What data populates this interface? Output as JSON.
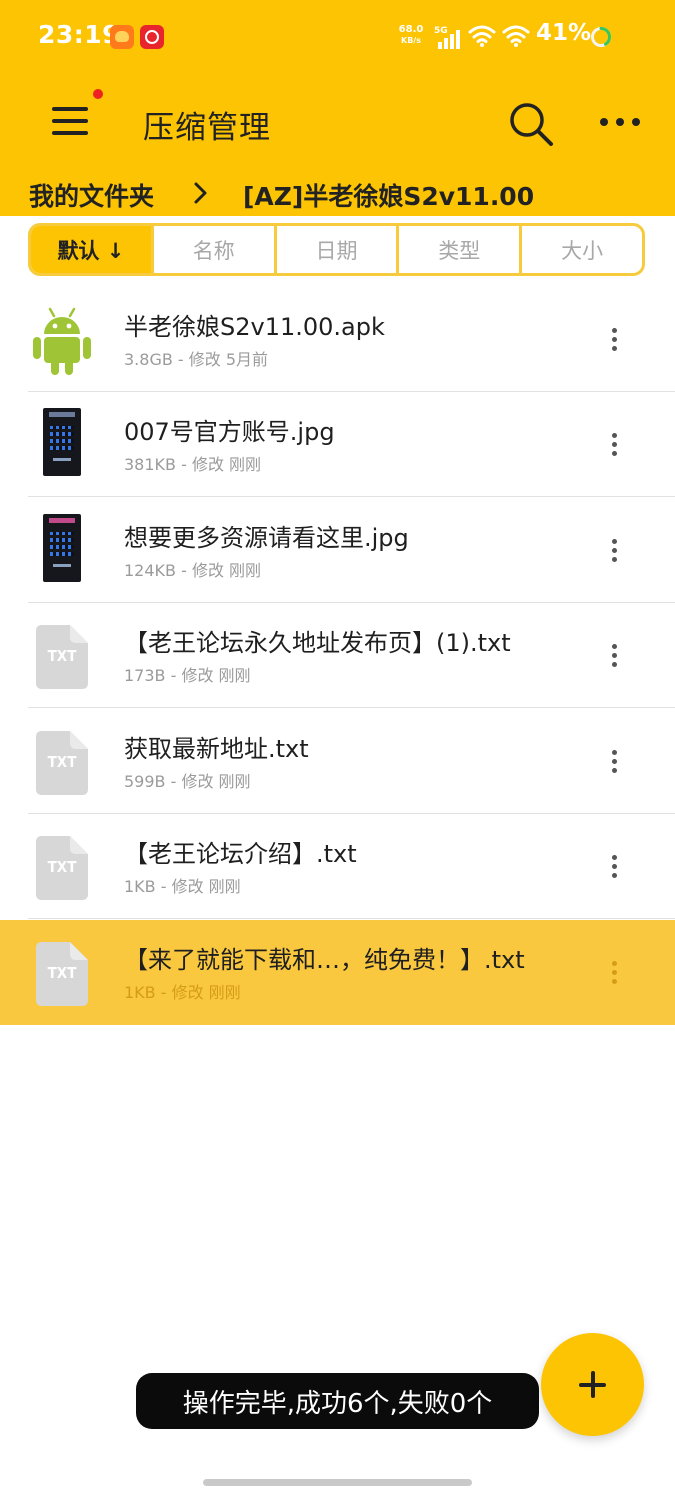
{
  "status_bar": {
    "time": "23:19",
    "net_speed_value": "68.0",
    "net_speed_unit": "KB/s",
    "signal_label": "5G",
    "battery": "41%",
    "battery_level": 0.41,
    "app_icons": [
      "taobao-app-icon",
      "netease-music-app-icon"
    ]
  },
  "toolbar": {
    "title": "压缩管理",
    "menu_icon": "hamburger-menu-icon",
    "has_notification_dot": true,
    "search_icon": "search-icon",
    "more_icon": "more-horizontal-icon"
  },
  "breadcrumb": {
    "root": "我的文件夹",
    "separator_icon": "chevron-right-icon",
    "current": "[AZ]半老徐娘S2v11.00"
  },
  "sort_tabs": [
    {
      "label": "默认 ↓",
      "active": true
    },
    {
      "label": "名称",
      "active": false
    },
    {
      "label": "日期",
      "active": false
    },
    {
      "label": "类型",
      "active": false
    },
    {
      "label": "大小",
      "active": false
    }
  ],
  "files": [
    {
      "name": "半老徐娘S2v11.00.apk",
      "meta": "3.8GB - 修改 5月前",
      "type": "apk",
      "icon": "android-apk-icon"
    },
    {
      "name": "007号官方账号.jpg",
      "meta": "381KB - 修改 刚刚",
      "type": "image",
      "icon": "image-thumbnail"
    },
    {
      "name": "想要更多资源请看这里.jpg",
      "meta": "124KB - 修改 刚刚",
      "type": "image",
      "icon": "image-thumbnail"
    },
    {
      "name": "【老王论坛永久地址发布页】(1).txt",
      "meta": "173B - 修改 刚刚",
      "type": "txt",
      "icon": "txt-file-icon",
      "icon_label": "TXT"
    },
    {
      "name": "获取最新地址.txt",
      "meta": "599B - 修改 刚刚",
      "type": "txt",
      "icon": "txt-file-icon",
      "icon_label": "TXT"
    },
    {
      "name": "【老王论坛介绍】.txt",
      "meta": "1KB - 修改 刚刚",
      "type": "txt",
      "icon": "txt-file-icon",
      "icon_label": "TXT"
    },
    {
      "name": "【来了就能下载和…，纯免费！】.txt",
      "meta": "1KB - 修改 刚刚",
      "type": "txt",
      "icon": "txt-file-icon",
      "icon_label": "TXT",
      "selected": true
    }
  ],
  "toast": {
    "text": "操作完毕,成功6个,失败0个"
  },
  "fab": {
    "icon": "plus-icon"
  },
  "colors": {
    "accent": "#fcc402",
    "selected_row": "#f9c83f",
    "sort_border": "#f7cb3e",
    "text": "#1f1f1f",
    "meta_text": "#9b9b9b",
    "android_green": "#9fc537"
  }
}
